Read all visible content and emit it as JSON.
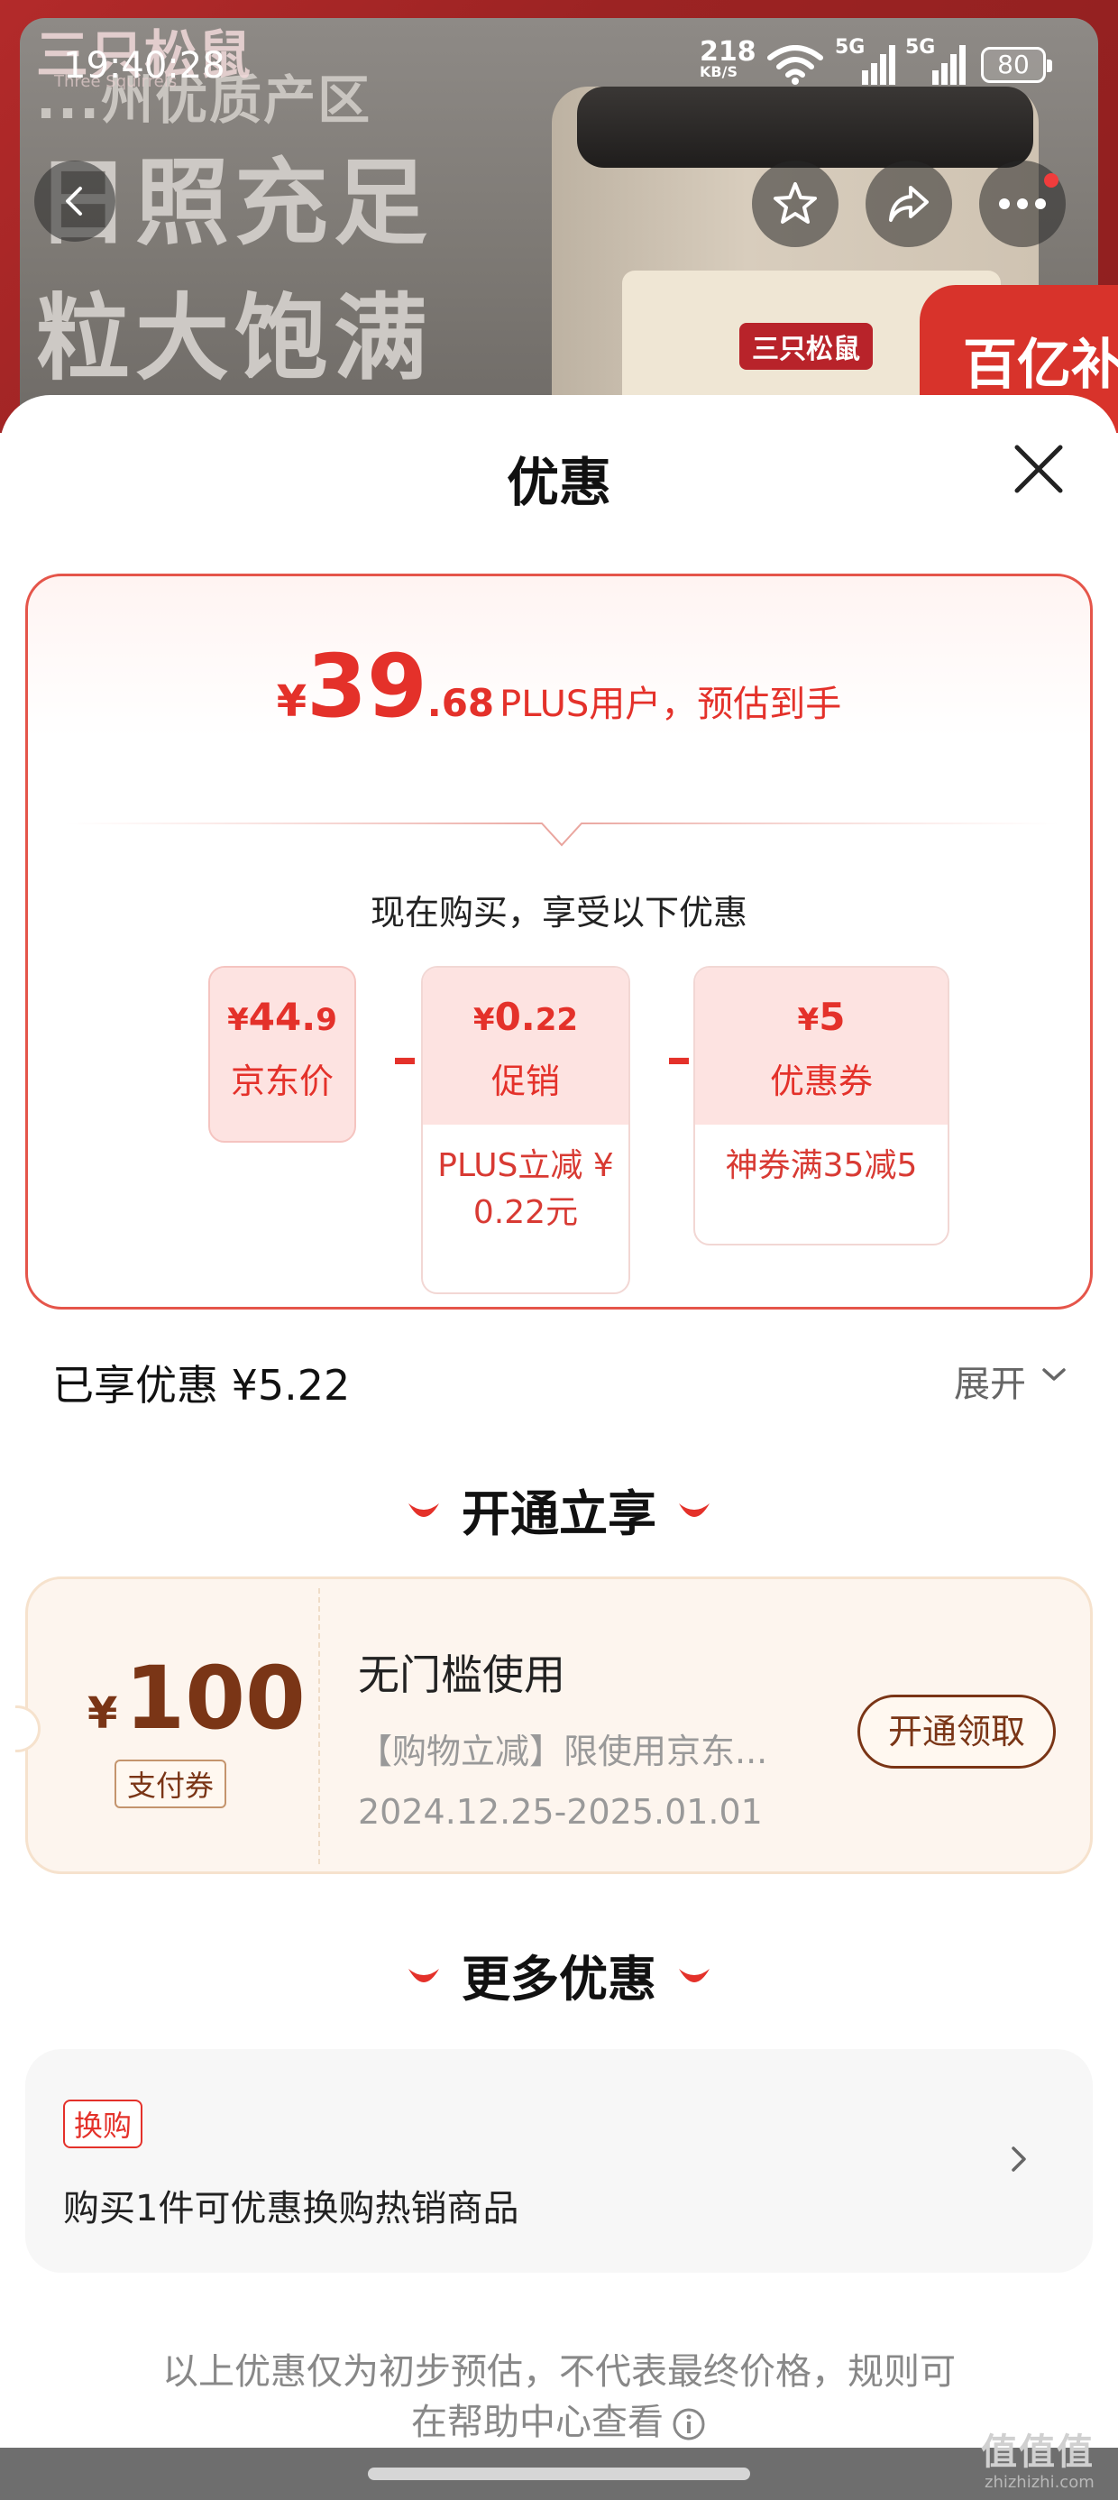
{
  "status_bar": {
    "time": "19:40:28",
    "net_speed": "218",
    "net_unit": "KB/S",
    "signal_1": "5G",
    "signal_2": "5G",
    "battery": "80"
  },
  "banner": {
    "brand": "三只松鼠",
    "brand_sub": "Three Squirrels",
    "slogan_top": "...州优质产区",
    "slogan_1": "日照充足",
    "slogan_2": "粒大饱满",
    "product_label": "三只松鼠",
    "corner_badge": "百亿补贴",
    "icons": {
      "back": "back-arrow-icon",
      "favorite": "star-icon",
      "share": "share-icon",
      "more": "more-dots-icon"
    }
  },
  "sheet": {
    "title": "优惠",
    "estimate": {
      "currency": "¥",
      "integer": "39",
      "decimal": ".68",
      "note": "PLUS用户，预估到手"
    },
    "now_buy": "现在购买，享受以下优惠",
    "breakdown": [
      {
        "currency": "¥",
        "amount": "44.",
        "decimal": "9",
        "label": "京东价",
        "detail": ""
      },
      {
        "currency": "¥",
        "amount": "0.",
        "decimal": "22",
        "label": "促销",
        "detail": "PLUS立减 ¥ 0.22元"
      },
      {
        "currency": "¥",
        "amount": "5",
        "decimal": "",
        "label": "优惠券",
        "detail": "神券满35减5"
      }
    ],
    "minus_sign": "–",
    "enjoyed": "已享优惠 ¥5.22",
    "expand": "展开"
  },
  "open_section": {
    "title": "开通立享",
    "coupon": {
      "currency": "¥",
      "value": "100",
      "tag": "支付券",
      "title": "无门槛使用",
      "desc": "【购物立减】限使用京东...",
      "dates": "2024.12.25-2025.01.01",
      "button": "开通领取"
    }
  },
  "more_section": {
    "title": "更多优惠",
    "item": {
      "tag": "换购",
      "desc": "购买1件可优惠换购热销商品"
    }
  },
  "footer_note": {
    "line1": "以上优惠仅为初步预估，不代表最终价格，规则可",
    "line2": "在帮助中心查看"
  },
  "watermark": {
    "text": "值值值",
    "sub": "zhizhizhi.com"
  },
  "colors": {
    "accent_red": "#e4312a",
    "coupon_brown": "#7a3516",
    "coupon_bg": "#fdf5ee"
  }
}
